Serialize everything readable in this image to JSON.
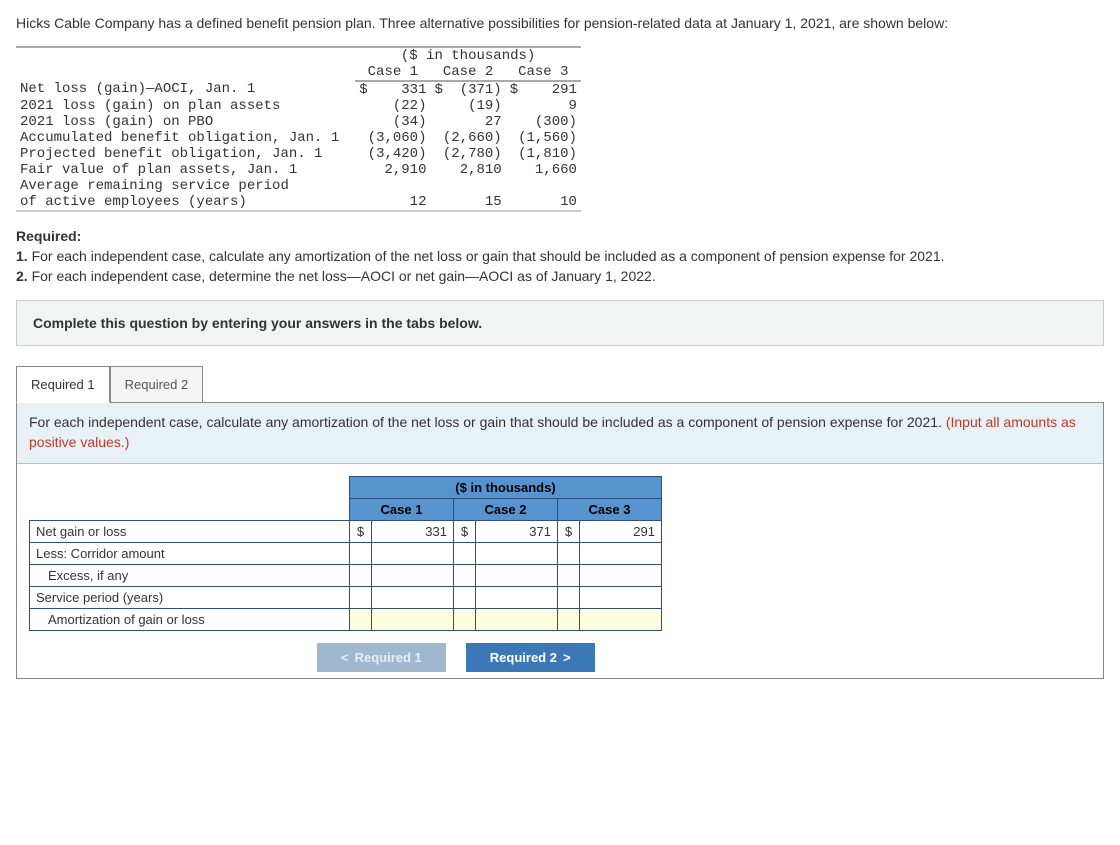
{
  "intro": "Hicks Cable Company has a defined benefit pension plan. Three alternative possibilities for pension-related data at January 1, 2021, are shown below:",
  "mono": {
    "super_head": "($ in thousands)",
    "cols": [
      "Case 1",
      "Case 2",
      "Case 3"
    ],
    "rows": [
      {
        "label": "Net loss (gain)—AOCI, Jan. 1",
        "c1": "$    331",
        "c2": "$  (371)",
        "c3": "$    291"
      },
      {
        "label": "2021 loss (gain) on plan assets",
        "c1": "(22)",
        "c2": "(19)",
        "c3": "9"
      },
      {
        "label": "2021 loss (gain) on PBO",
        "c1": "(34)",
        "c2": "27",
        "c3": "(300)"
      },
      {
        "label": "Accumulated benefit obligation, Jan. 1",
        "c1": "(3,060)",
        "c2": "(2,660)",
        "c3": "(1,560)"
      },
      {
        "label": "Projected benefit obligation, Jan. 1",
        "c1": "(3,420)",
        "c2": "(2,780)",
        "c3": "(1,810)"
      },
      {
        "label": "Fair value of plan assets, Jan. 1",
        "c1": "2,910",
        "c2": "2,810",
        "c3": "1,660"
      },
      {
        "label": "Average remaining service period",
        "c1": "",
        "c2": "",
        "c3": ""
      },
      {
        "label": "of active employees (years)",
        "c1": "12",
        "c2": "15",
        "c3": "10"
      }
    ]
  },
  "required": {
    "title": "Required:",
    "item1_num": "1.",
    "item1": "For each independent case, calculate any amortization of the net loss or gain that should be included as a component of pension expense for 2021.",
    "item2_num": "2.",
    "item2": "For each independent case, determine the net loss—AOCI or net gain—AOCI as of January 1, 2022."
  },
  "instruction_box": "Complete this question by entering your answers in the tabs below.",
  "tabs": {
    "tab1": "Required 1",
    "tab2": "Required 2"
  },
  "tab_instructions_main": "For each independent case, calculate any amortization of the net loss or gain that should be included as a component of pension expense for 2021. ",
  "tab_instructions_red": "(Input all amounts as positive values.)",
  "answer": {
    "super_head": "($ in thousands)",
    "colheads": [
      "Case 1",
      "Case 2",
      "Case 3"
    ],
    "row_labels": {
      "r1": "Net gain or loss",
      "r2": "Less: Corridor amount",
      "r3": "Excess, if any",
      "r4": "Service period (years)",
      "r5": "Amortization of gain or loss"
    },
    "r1": {
      "cur1": "$",
      "v1": "331",
      "cur2": "$",
      "v2": "371",
      "cur3": "$",
      "v3": "291"
    }
  },
  "nav": {
    "prev_label": "Required 1",
    "next_label": "Required 2"
  }
}
